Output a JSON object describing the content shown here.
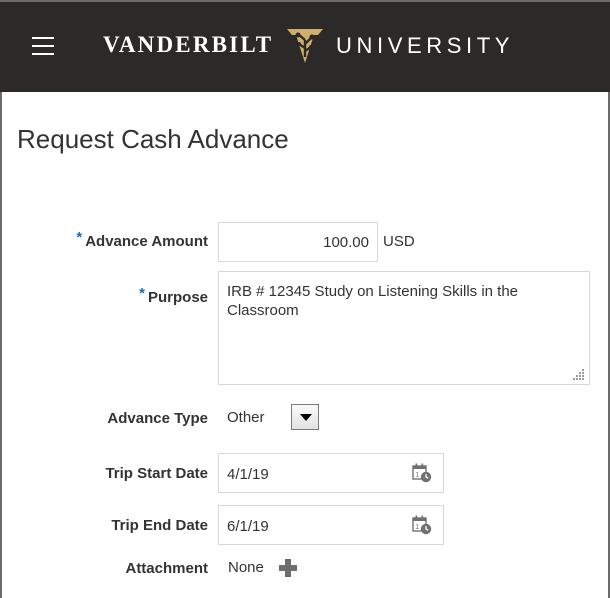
{
  "header": {
    "brand_left": "VANDERBILT",
    "brand_right": "UNIVERSITY",
    "icons": [
      "hamburger-menu-icon",
      "vanderbilt-oak-leaf-logo"
    ],
    "colors": {
      "bar": "#2c2a29",
      "gold": "#cfae70",
      "text": "#ffffff"
    }
  },
  "page": {
    "title": "Request Cash Advance"
  },
  "form": {
    "required_marker": "*",
    "advance_amount": {
      "label": "Advance Amount",
      "value": "100.00",
      "currency": "USD"
    },
    "purpose": {
      "label": "Purpose",
      "value": "IRB # 12345 Study on Listening Skills in the Classroom"
    },
    "advance_type": {
      "label": "Advance Type",
      "value": "Other"
    },
    "trip_start_date": {
      "label": "Trip Start Date",
      "value": "4/1/19"
    },
    "trip_end_date": {
      "label": "Trip End Date",
      "value": "6/1/19"
    },
    "attachment": {
      "label": "Attachment",
      "value": "None"
    }
  },
  "colors": {
    "required": "#1c6bb5",
    "field_border": "#d5d9dd",
    "text": "#333333"
  }
}
